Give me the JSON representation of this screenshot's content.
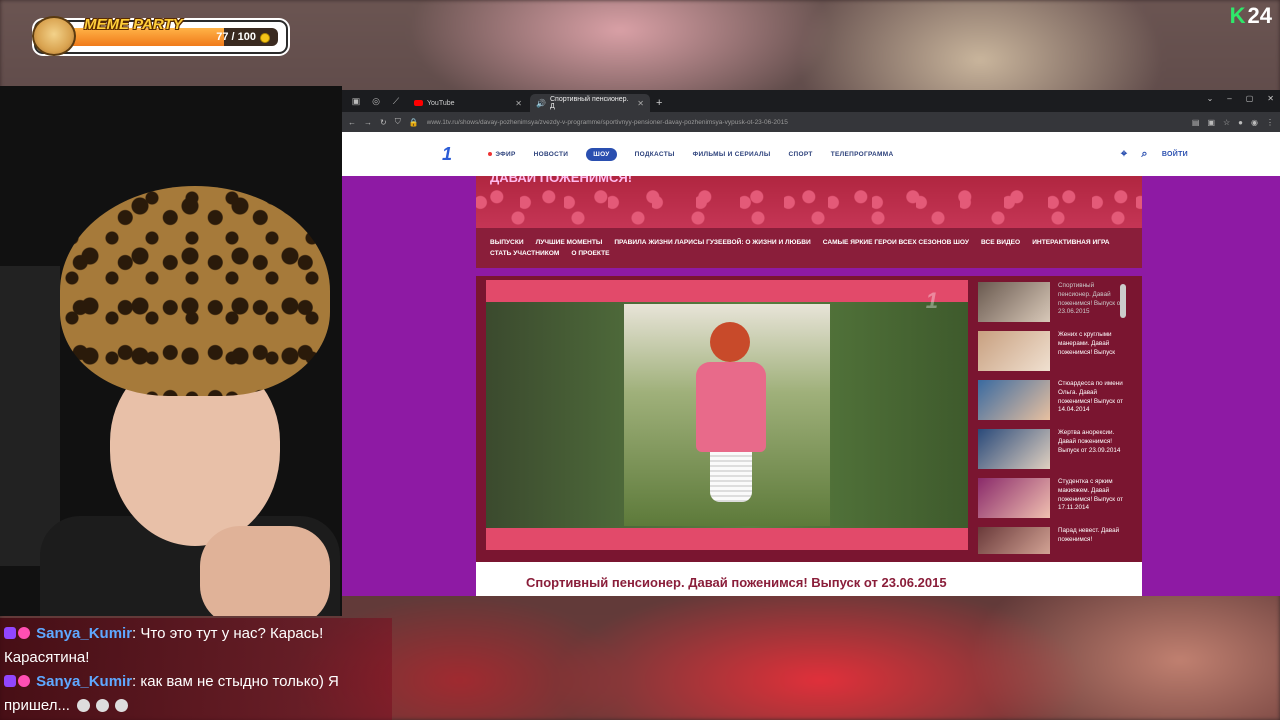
{
  "hud": {
    "title": "MEME PARTY",
    "count": "77 / 100",
    "progress": 0.77
  },
  "corner_logo": {
    "k": "K",
    "num": "24"
  },
  "browser": {
    "tabs": [
      {
        "label": "YouTube",
        "active": false
      },
      {
        "label": "Спортивный пенсионер. Д",
        "active": true
      }
    ],
    "url": "www.1tv.ru/shows/davay-pozhenimsya/zvezdy-v-programme/sportivnyy-pensioner-davay-pozhenimsya-vypusk-ot-23-06-2015"
  },
  "site": {
    "logo": "1",
    "nav": [
      "ЭФИР",
      "НОВОСТИ",
      "ШОУ",
      "ПОДКАСТЫ",
      "ФИЛЬМЫ И СЕРИАЛЫ",
      "СПОРТ",
      "ТЕЛЕПРОГРАММА"
    ],
    "login": "ВОЙТИ",
    "show_title": "ДАВАЙ ПОЖЕНИМСЯ!",
    "subnav": [
      "ВЫПУСКИ",
      "ЛУЧШИЕ МОМЕНТЫ",
      "ПРАВИЛА ЖИЗНИ ЛАРИСЫ ГУЗЕЕВОЙ: О ЖИЗНИ И ЛЮБВИ",
      "САМЫЕ ЯРКИЕ ГЕРОИ ВСЕХ СЕЗОНОВ ШОУ",
      "ВСЕ ВИДЕО",
      "ИНТЕРАКТИВНАЯ ИГРА",
      "СТАТЬ УЧАСТНИКОМ",
      "О ПРОЕКТЕ"
    ],
    "watermark": "1",
    "related": [
      {
        "text": "Спортивный пенсионер. Давай поженимся! Выпуск от 23.06.2015",
        "dim": true
      },
      {
        "text": "Жених с круглыми манерами. Давай поженимся! Выпуск",
        "dim": false
      },
      {
        "text": "Стюардесса по имени Ольга. Давай поженимся! Выпуск от 14.04.2014",
        "dim": false
      },
      {
        "text": "Жертва анорексии. Давай поженимся! Выпуск от 23.09.2014",
        "dim": false
      },
      {
        "text": "Студентка с ярким макияжем. Давай поженимся! Выпуск от 17.11.2014",
        "dim": false
      },
      {
        "text": "Парад невест. Давай поженимся!",
        "dim": false
      }
    ],
    "video_title": "Спортивный пенсионер. Давай поженимся! Выпуск от 23.06.2015"
  },
  "chat": [
    {
      "user": "Sanya_Kumir",
      "text": ": Что это тут у нас? Карась! Карасятина!",
      "emotes": 0
    },
    {
      "user": "Sanya_Kumir",
      "text": ": как вам не стыдно только) Я пришел...",
      "emotes": 3
    }
  ]
}
